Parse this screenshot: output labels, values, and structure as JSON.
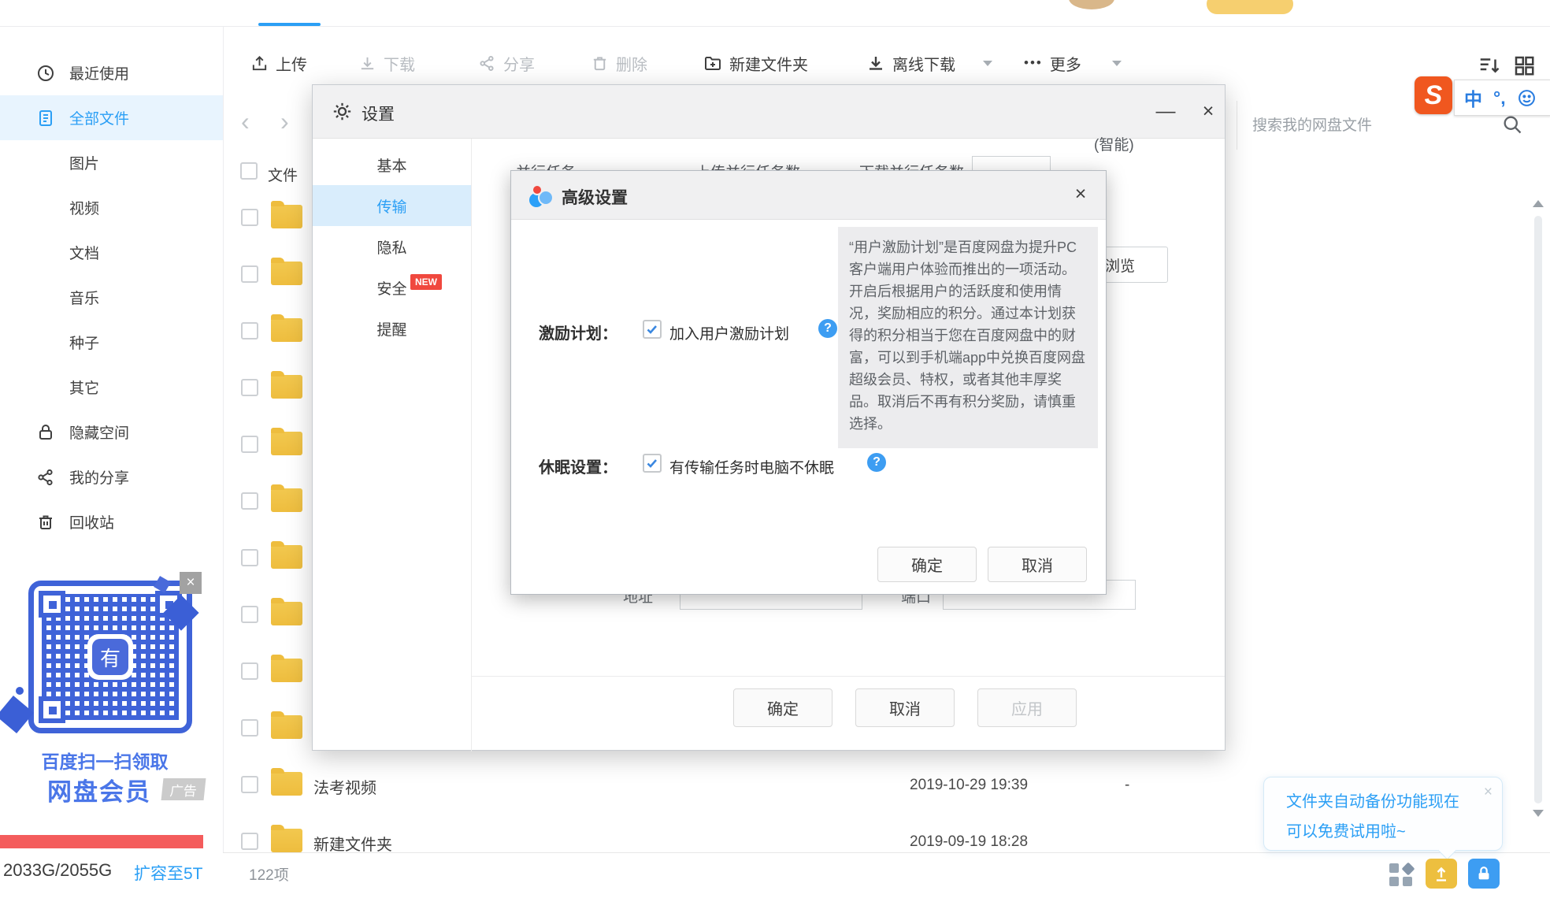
{
  "colors": {
    "accent_blue": "#2b9ff5",
    "new_badge_red": "#f0483e",
    "storage_bar_red": "#f45c5c",
    "folder_yellow": "#eebd3e",
    "qr_blue": "#3f63d8",
    "sogou_orange": "#f0571f",
    "lock_button_blue": "#3d9df2"
  },
  "sidebar": {
    "nav": [
      {
        "label": "最近使用"
      },
      {
        "label": "全部文件",
        "active": true
      },
      {
        "label": "图片"
      },
      {
        "label": "视频"
      },
      {
        "label": "文档"
      },
      {
        "label": "音乐"
      },
      {
        "label": "种子"
      },
      {
        "label": "其它"
      },
      {
        "label": "隐藏空间"
      },
      {
        "label": "我的分享"
      },
      {
        "label": "回收站"
      }
    ],
    "qr_ad": {
      "close": "×",
      "center_glyph": "有",
      "line1": "百度扫一扫领取",
      "line2": "网盘会员",
      "badge": "广告"
    },
    "storage": {
      "usage": "2033G/2055G",
      "upgrade_link": "扩容至5T"
    }
  },
  "toolbar": {
    "upload": "上传",
    "download": "下载",
    "share": "分享",
    "delete": "删除",
    "new_folder": "新建文件夹",
    "offline_download": "离线下载",
    "more_dots": "•••",
    "more": "更多"
  },
  "nav_arrows": {
    "back": "‹",
    "forward": "›"
  },
  "search": {
    "placeholder": "搜索我的网盘文件"
  },
  "ime": {
    "logo": "S",
    "lang": "中",
    "punct": "°,"
  },
  "file_list": {
    "header": "文件",
    "rows": [
      {
        "name": "法考视频",
        "date": "2019-10-29 19:39",
        "size": "-"
      },
      {
        "name": "新建文件夹",
        "date": "2019-09-19 18:28",
        "size": ""
      }
    ]
  },
  "status_bar": {
    "item_count": "122项"
  },
  "backup_tooltip": {
    "line1": "文件夹自动备份功能现在",
    "line2": "可以免费试用啦~",
    "close": "×"
  },
  "settings_dialog": {
    "title": "设置",
    "minimize": "—",
    "close": "×",
    "tabs": [
      {
        "label": "基本"
      },
      {
        "label": "传输",
        "active": true
      },
      {
        "label": "隐私"
      },
      {
        "label": "安全",
        "badge": "NEW"
      },
      {
        "label": "提醒"
      }
    ],
    "background_fragments": {
      "parallel_label": "并行任务",
      "upload_tasks": "上传并行任务数",
      "download_tasks": "下载并行任务数",
      "smart": "(智能)",
      "address": "地址",
      "port": "端口",
      "browse": "浏览"
    },
    "buttons": {
      "ok": "确定",
      "cancel": "取消",
      "apply": "应用"
    }
  },
  "advanced_dialog": {
    "title": "高级设置",
    "close": "×",
    "incentive": {
      "label": "激励计划：",
      "checkbox_label": "加入用户激励计划",
      "checked": true,
      "help": "?"
    },
    "sleep": {
      "label": "休眠设置：",
      "checkbox_label": "有传输任务时电脑不休眠",
      "checked": true,
      "help": "?"
    },
    "description": "“用户激励计划”是百度网盘为提升PC客户端用户体验而推出的一项活动。开启后根据用户的活跃度和使用情况，奖励相应的积分。通过本计划获得的积分相当于您在百度网盘中的财富，可以到手机端app中兑换百度网盘超级会员、特权，或者其他丰厚奖品。取消后不再有积分奖励，请慎重选择。",
    "buttons": {
      "ok": "确定",
      "cancel": "取消"
    }
  }
}
